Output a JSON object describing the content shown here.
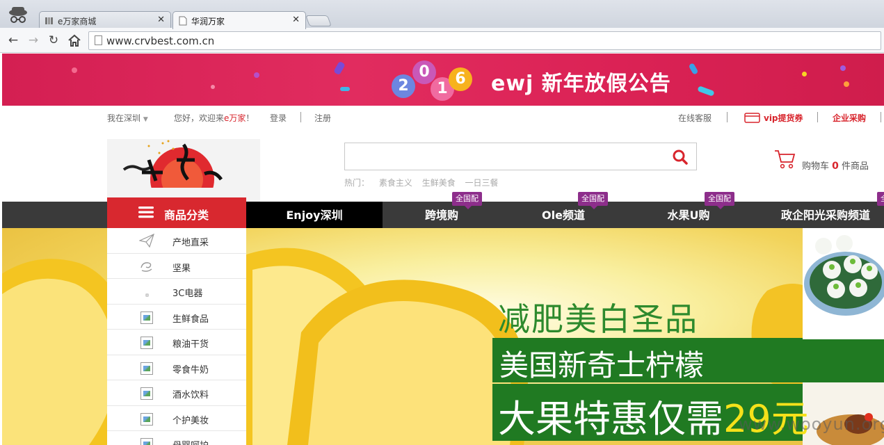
{
  "browser": {
    "tabs": [
      {
        "label": "e万家商城",
        "active": false
      },
      {
        "label": "华润万家",
        "active": true
      }
    ],
    "url": "www.crvbest.com.cn"
  },
  "banner": {
    "year_digits": [
      "2",
      "0",
      "1",
      "6"
    ],
    "text": "ewj 新年放假公告"
  },
  "topbar": {
    "location": "我在深圳",
    "welcome_prefix": "您好，欢迎来",
    "welcome_brand": "e万家",
    "welcome_suffix": "！",
    "login": "登录",
    "register": "注册",
    "service": "在线客服",
    "vip": "vip提货券",
    "enterprise": "企业采购"
  },
  "search": {
    "value": "",
    "hot_label": "热门：",
    "hot_terms": [
      "素食主义",
      "生鲜美食",
      "一日三餐"
    ]
  },
  "cart": {
    "label": "购物车",
    "count": "0",
    "unit": "件商品"
  },
  "categories": {
    "title": "商品分类",
    "items": [
      {
        "label": "产地直采",
        "icon": "paper-plane-icon"
      },
      {
        "label": "坚果",
        "icon": "nut-icon"
      },
      {
        "label": "3C电器",
        "icon": "dot-icon"
      },
      {
        "label": "生鲜食品",
        "icon": "broken-image-icon"
      },
      {
        "label": "粮油干货",
        "icon": "broken-image-icon"
      },
      {
        "label": "零食牛奶",
        "icon": "broken-image-icon"
      },
      {
        "label": "酒水饮料",
        "icon": "broken-image-icon"
      },
      {
        "label": "个护美妆",
        "icon": "broken-image-icon"
      },
      {
        "label": "母婴呵护",
        "icon": "broken-image-icon"
      }
    ]
  },
  "nav": [
    {
      "label": "Enjoy深圳",
      "tag": ""
    },
    {
      "label": "跨境购",
      "tag": "全国配"
    },
    {
      "label": "Ole频道",
      "tag": "全国配"
    },
    {
      "label": "水果U购",
      "tag": "全国配"
    },
    {
      "label": "政企阳光采购频道",
      "tag": "全国"
    }
  ],
  "hero": {
    "headline": "减肥美白圣品",
    "sub": "美国新奇士柠檬",
    "offer": "大果特惠仅需",
    "price": "29元"
  },
  "watermark": "www.wooyun.org",
  "colors": {
    "brand_red": "#d8282f",
    "banner_pink": "#dc2457",
    "nav_dark": "#3a3a3a",
    "tag_purple": "#8d2e8b",
    "hero_green": "#207a22"
  }
}
